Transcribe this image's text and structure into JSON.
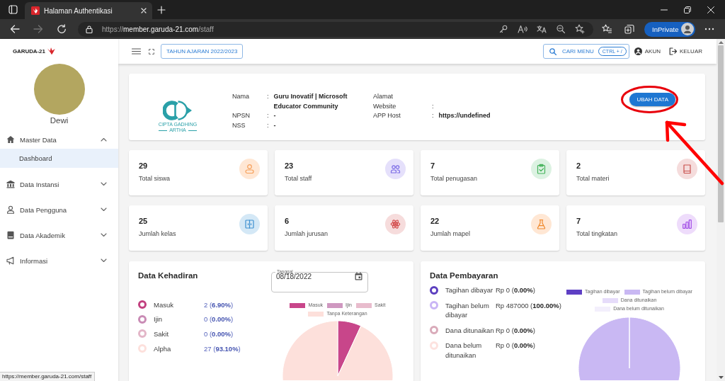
{
  "browser": {
    "tab_title": "Halaman Authentikasi",
    "address": {
      "scheme": "https://",
      "host": "member.garuda-21.com",
      "path": "/staff"
    },
    "back_disabled": false,
    "forward_disabled": true,
    "profile_label": "InPrivate",
    "status_url": "https://member.garuda-21.com/staff"
  },
  "sidebar": {
    "brand": "GARUDA-21",
    "user_name": "Dewi",
    "menu": [
      {
        "label": "Master Data",
        "kind": "home",
        "expanded": true,
        "selected": false,
        "children": [
          {
            "label": "Dashboard",
            "selected": true
          }
        ]
      },
      {
        "label": "Data Instansi",
        "kind": "institution",
        "expanded": false,
        "selected": false
      },
      {
        "label": "Data Pengguna",
        "kind": "user",
        "expanded": false,
        "selected": false
      },
      {
        "label": "Data Akademik",
        "kind": "book",
        "expanded": false,
        "selected": false
      },
      {
        "label": "Informasi",
        "kind": "announcement",
        "expanded": false,
        "selected": false
      }
    ]
  },
  "header": {
    "year_button": "TAHUN AJARAN 2022/2023",
    "search": {
      "label": "CARI MENU",
      "shortcut": "CTRL + /"
    },
    "account": "AKUN",
    "logout": "KELUAR"
  },
  "school": {
    "logo_text": [
      "CIPTA GADHING",
      "ARTHA"
    ],
    "detail_columns": [
      {
        "rows": [
          {
            "label": "Nama",
            "separator": ":",
            "value": "Guru Inovatif | Microsoft Educator Community"
          },
          {
            "label": "NPSN",
            "separator": ":",
            "value": "-"
          },
          {
            "label": "NSS",
            "separator": ":",
            "value": "-"
          }
        ]
      },
      {
        "rows": [
          {
            "label": "Alamat"
          },
          {
            "label": "Website",
            "separator": ":"
          },
          {
            "label": "APP Host",
            "separator": ":",
            "value": "https://undefined"
          }
        ]
      }
    ],
    "edit_button": "UBAH DATA"
  },
  "stats": [
    {
      "value": "29",
      "label": "Total siswa",
      "kind": "student"
    },
    {
      "value": "23",
      "label": "Total staff",
      "kind": "staff"
    },
    {
      "value": "7",
      "label": "Total penugasan",
      "kind": "assignment"
    },
    {
      "value": "2",
      "label": "Total materi",
      "kind": "material"
    },
    {
      "value": "25",
      "label": "Jumlah kelas",
      "kind": "classroom"
    },
    {
      "value": "6",
      "label": "Jumlah jurusan",
      "kind": "major"
    },
    {
      "value": "22",
      "label": "Jumlah mapel",
      "kind": "subject"
    },
    {
      "value": "7",
      "label": "Total tingkatan",
      "kind": "grade"
    }
  ],
  "attendance": {
    "title": "Data Kehadiran",
    "date_field": {
      "label": "Tanggal",
      "value": "08/18/2022"
    },
    "items": [
      {
        "label": "Masuk",
        "value": "2 (**6.90%**)",
        "color": "#c2407f"
      },
      {
        "label": "Ijin",
        "value": "0 (**0.00%**)",
        "color": "#c98bb5"
      },
      {
        "label": "Sakit",
        "value": "0 (**0.00%**)",
        "color": "#e3b6c8"
      },
      {
        "label": "Alpha",
        "value": "27 (**93.10%**)",
        "color": "#fde0dc"
      }
    ],
    "chart_data": {
      "type": "pie",
      "categories": [
        "Masuk",
        "Ijin",
        "Sakit",
        "Tanpa Keterangan"
      ],
      "values": [
        6.9,
        0,
        0,
        93.1
      ],
      "colors": [
        "#c8468a",
        "#cf98c0",
        "#e8bccd",
        "#fde0db"
      ],
      "legend": "top"
    }
  },
  "payment": {
    "title": "Data Pembayaran",
    "items": [
      {
        "label": "Tagihan dibayar",
        "value": "Rp 0 (**0.00%**)",
        "color": "#5c3fbf"
      },
      {
        "label": "Tagihan belum dibayar",
        "value": "Rp 487000 (**100.00%**)",
        "color": "#c9b5f5"
      },
      {
        "label": "Dana ditunaikan",
        "value": "Rp 0 (**0.00%**)",
        "color": "#d9aab9"
      },
      {
        "label": "Dana belum ditunaikan",
        "value": "Rp 0 (**0.00%**)",
        "color": "#fde2df"
      }
    ],
    "chart_data": {
      "type": "pie",
      "categories": [
        "Tagihan dibayar",
        "Tagihan belum dibayar",
        "Dana ditunaikan",
        "Dana belum ditunaikan"
      ],
      "values": [
        0,
        100,
        0,
        0
      ],
      "colors": [
        "#5e3fc4",
        "#c9b8f3",
        "#e6dcfa",
        "#f3effc"
      ],
      "legend": "top"
    }
  },
  "annotations": [
    {
      "kind": "ellipse"
    },
    {
      "kind": "arrow"
    }
  ]
}
